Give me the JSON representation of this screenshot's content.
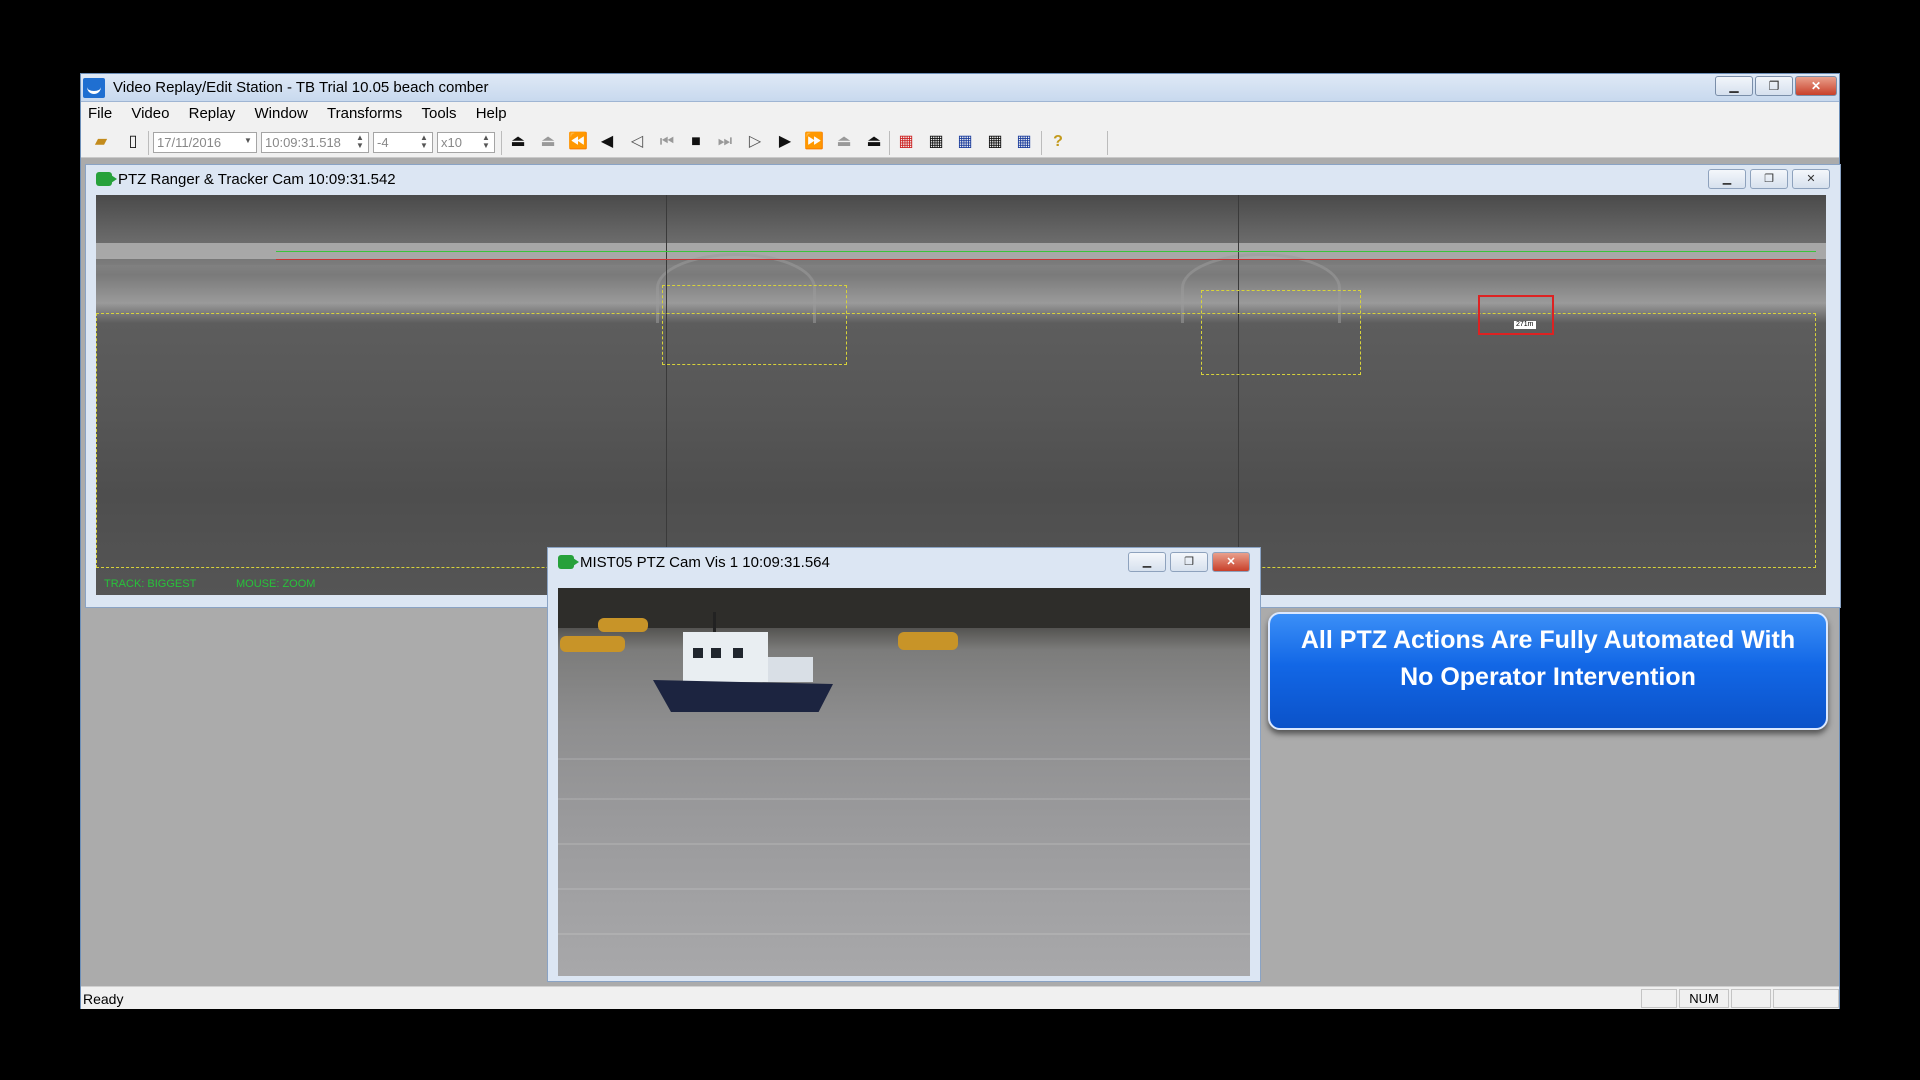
{
  "app": {
    "title": "Video Replay/Edit Station - TB Trial 10.05 beach comber",
    "window_controls": {
      "minimize": "▁",
      "restore": "❐",
      "close": "✕"
    }
  },
  "menu": [
    "File",
    "Video",
    "Replay",
    "Window",
    "Transforms",
    "Tools",
    "Help"
  ],
  "toolbar": {
    "date": "17/11/2016",
    "time": "10:09:31.518",
    "step": "-4",
    "speed": "x10",
    "icons": [
      "open-folder-icon",
      "clipboard-icon",
      "eject-left-icon",
      "eject-left-grey-icon",
      "rewind-fast-icon",
      "rewind-icon",
      "step-back-icon",
      "skip-start-icon",
      "stop-icon",
      "skip-end-icon",
      "play-step-icon",
      "play-icon",
      "fast-forward-icon",
      "eject-right-grey-icon",
      "eject-right-icon",
      "grid-red-icon",
      "grid-9-icon",
      "grid-blue-icon",
      "grid-4-icon",
      "grid-blue-2-icon",
      "help-icon"
    ]
  },
  "ptz_window": {
    "title": "PTZ Ranger & Tracker Cam 10:09:31.542",
    "status_left": "TRACK: BIGGEST",
    "status_right": "MOUSE: ZOOM",
    "track_label": "271m"
  },
  "vis_window": {
    "title": "MIST05 PTZ Cam Vis 1 10:09:31.564"
  },
  "callout": {
    "line1": "All PTZ Actions Are Fully Automated With",
    "line2": "No Operator Intervention"
  },
  "statusbar": {
    "text": "Ready",
    "num": "NUM"
  },
  "colors": {
    "callout_blue": "#1267e6",
    "track_red": "#dd2222",
    "zone_yellow": "#d8d33a",
    "overlay_green": "#27c23a"
  }
}
